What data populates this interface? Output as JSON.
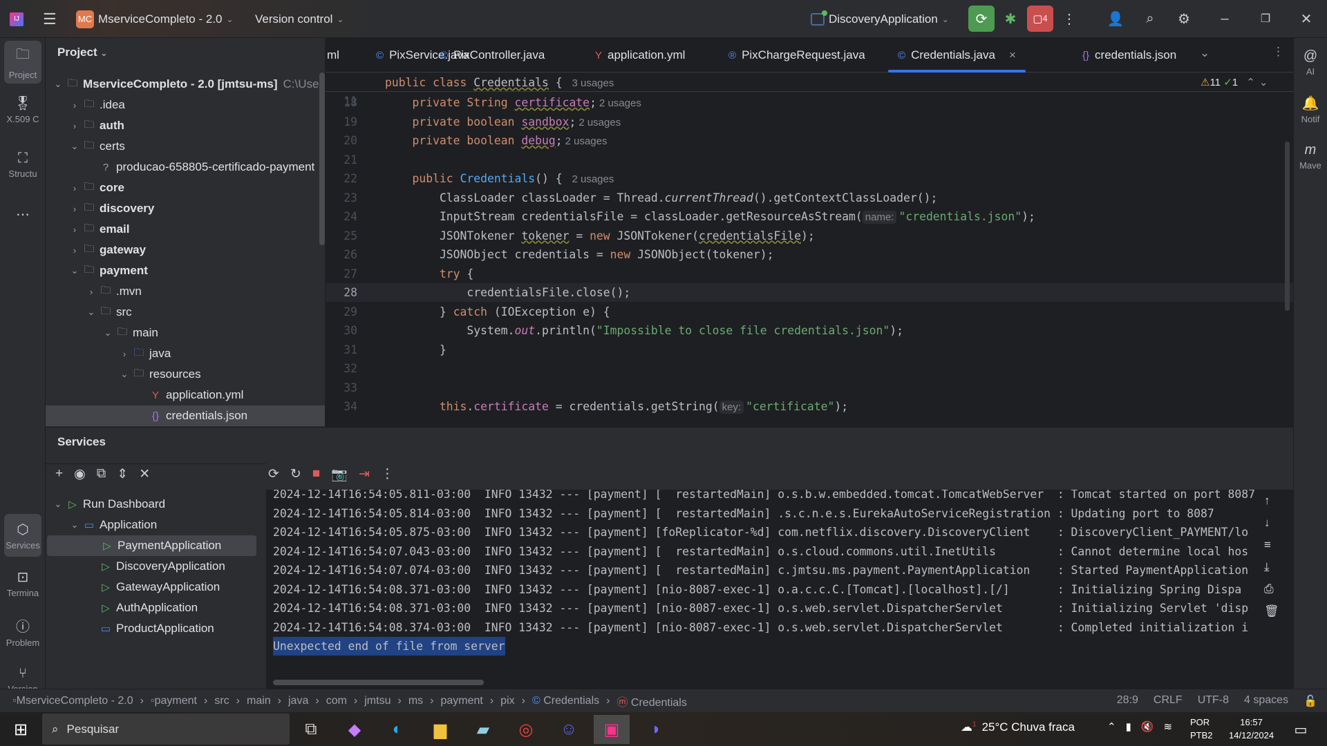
{
  "titlebar": {
    "project_initials": "MC",
    "project_name": "MserviceCompleto - 2.0",
    "vcs": "Version control",
    "run_config": "DiscoveryApplication",
    "stop_badge": "4"
  },
  "leftstrip": [
    {
      "label": "Project",
      "icon": "folder-icon"
    },
    {
      "label": "X.509 C",
      "icon": "certificate-icon"
    },
    {
      "label": "Structu",
      "icon": "structure-icon"
    },
    {
      "label": "Services",
      "icon": "services-icon"
    },
    {
      "label": "Termina",
      "icon": "terminal-icon"
    },
    {
      "label": "Problem",
      "icon": "problems-icon"
    },
    {
      "label": "Version",
      "icon": "git-branch-icon"
    }
  ],
  "project": {
    "title": "Project",
    "root_name": "MserviceCompleto - 2.0 [jmtsu-ms]",
    "root_path": "C:\\Use",
    "items": [
      {
        "label": ".idea",
        "depth": 1,
        "state": "collapsed",
        "kind": "folder"
      },
      {
        "label": "auth",
        "depth": 1,
        "state": "collapsed",
        "kind": "module",
        "bold": true
      },
      {
        "label": "certs",
        "depth": 1,
        "state": "expanded",
        "kind": "folder"
      },
      {
        "label": "producao-658805-certificado-payment",
        "depth": 2,
        "state": "leaf",
        "kind": "unknown"
      },
      {
        "label": "core",
        "depth": 1,
        "state": "collapsed",
        "kind": "module",
        "bold": true
      },
      {
        "label": "discovery",
        "depth": 1,
        "state": "collapsed",
        "kind": "module",
        "bold": true
      },
      {
        "label": "email",
        "depth": 1,
        "state": "collapsed",
        "kind": "module",
        "bold": true
      },
      {
        "label": "gateway",
        "depth": 1,
        "state": "collapsed",
        "kind": "module",
        "bold": true
      },
      {
        "label": "payment",
        "depth": 1,
        "state": "expanded",
        "kind": "module",
        "bold": true
      },
      {
        "label": ".mvn",
        "depth": 2,
        "state": "collapsed",
        "kind": "folder"
      },
      {
        "label": "src",
        "depth": 2,
        "state": "expanded",
        "kind": "folder"
      },
      {
        "label": "main",
        "depth": 3,
        "state": "expanded",
        "kind": "folder"
      },
      {
        "label": "java",
        "depth": 4,
        "state": "collapsed",
        "kind": "source"
      },
      {
        "label": "resources",
        "depth": 4,
        "state": "expanded",
        "kind": "resources"
      },
      {
        "label": "application.yml",
        "depth": 5,
        "state": "leaf",
        "kind": "yaml"
      },
      {
        "label": "credentials.json",
        "depth": 5,
        "state": "leaf",
        "kind": "json",
        "selected": true
      }
    ]
  },
  "tabs": [
    {
      "label": "ml",
      "kind": "partial"
    },
    {
      "label": "PixService.java",
      "kind": "class"
    },
    {
      "label": "PixController.java",
      "kind": "class"
    },
    {
      "label": "application.yml",
      "kind": "yaml"
    },
    {
      "label": "PixChargeRequest.java",
      "kind": "record"
    },
    {
      "label": "Credentials.java",
      "kind": "class",
      "active": true
    },
    {
      "label": "credentials.json",
      "kind": "json"
    }
  ],
  "inspections": {
    "warnings": "11",
    "ok": "1"
  },
  "sticky": {
    "num": "11",
    "tokens": [
      {
        "t": "public class ",
        "c": "kw"
      },
      {
        "t": "Credentials",
        "c": "pl ul"
      },
      {
        "t": " { ",
        "c": "pl"
      },
      {
        "t": "3 usages",
        "c": "hint"
      }
    ]
  },
  "code": [
    {
      "num": "18",
      "tokens": [
        {
          "t": "    private String ",
          "c": "kw"
        },
        {
          "t": "certificate",
          "c": "fld ul"
        },
        {
          "t": ";",
          "c": "pl"
        },
        {
          "t": "2 usages",
          "c": "hint"
        }
      ]
    },
    {
      "num": "19",
      "tokens": [
        {
          "t": "    private boolean ",
          "c": "kw"
        },
        {
          "t": "sandbox",
          "c": "fld ul"
        },
        {
          "t": ";",
          "c": "pl"
        },
        {
          "t": "2 usages",
          "c": "hint"
        }
      ]
    },
    {
      "num": "20",
      "tokens": [
        {
          "t": "    private boolean ",
          "c": "kw"
        },
        {
          "t": "debug",
          "c": "fld ul"
        },
        {
          "t": ";",
          "c": "pl"
        },
        {
          "t": "2 usages",
          "c": "hint"
        }
      ]
    },
    {
      "num": "21",
      "tokens": []
    },
    {
      "num": "22",
      "tokens": [
        {
          "t": "    public ",
          "c": "kw"
        },
        {
          "t": "Credentials",
          "c": "fn"
        },
        {
          "t": "() { ",
          "c": "pl"
        },
        {
          "t": "2 usages",
          "c": "hint"
        }
      ]
    },
    {
      "num": "23",
      "tokens": [
        {
          "t": "        ClassLoader classLoader = Thread.",
          "c": "pl"
        },
        {
          "t": "currentThread",
          "c": "pl it"
        },
        {
          "t": "().getContextClassLoader();",
          "c": "pl"
        }
      ]
    },
    {
      "num": "24",
      "tokens": [
        {
          "t": "        InputStream credentialsFile = classLoader.getResourceAsStream(",
          "c": "pl"
        },
        {
          "t": "name:",
          "c": "inlay"
        },
        {
          "t": "\"credentials.json\"",
          "c": "str"
        },
        {
          "t": ");",
          "c": "pl"
        }
      ]
    },
    {
      "num": "25",
      "tokens": [
        {
          "t": "        JSONTokener ",
          "c": "pl"
        },
        {
          "t": "tokener",
          "c": "pl ul"
        },
        {
          "t": " = ",
          "c": "pl"
        },
        {
          "t": "new ",
          "c": "kw"
        },
        {
          "t": "JSONTokener(",
          "c": "pl"
        },
        {
          "t": "credentialsFile",
          "c": "pl ul"
        },
        {
          "t": ");",
          "c": "pl"
        }
      ]
    },
    {
      "num": "26",
      "tokens": [
        {
          "t": "        JSONObject credentials = ",
          "c": "pl"
        },
        {
          "t": "new ",
          "c": "kw"
        },
        {
          "t": "JSONObject(tokener);",
          "c": "pl"
        }
      ]
    },
    {
      "num": "27",
      "tokens": [
        {
          "t": "        try ",
          "c": "kw"
        },
        {
          "t": "{",
          "c": "pl"
        }
      ]
    },
    {
      "num": "28",
      "current": true,
      "tokens": [
        {
          "t": "            credentialsFile.close();",
          "c": "pl"
        }
      ]
    },
    {
      "num": "29",
      "tokens": [
        {
          "t": "        } ",
          "c": "pl"
        },
        {
          "t": "catch ",
          "c": "kw"
        },
        {
          "t": "(IOException e) {",
          "c": "pl"
        }
      ]
    },
    {
      "num": "30",
      "tokens": [
        {
          "t": "            System.",
          "c": "pl"
        },
        {
          "t": "out",
          "c": "fld it"
        },
        {
          "t": ".println(",
          "c": "pl"
        },
        {
          "t": "\"Impossible to close file credentials.json\"",
          "c": "str"
        },
        {
          "t": ");",
          "c": "pl"
        }
      ]
    },
    {
      "num": "31",
      "tokens": [
        {
          "t": "        }",
          "c": "pl"
        }
      ]
    },
    {
      "num": "32",
      "tokens": []
    },
    {
      "num": "33",
      "tokens": []
    },
    {
      "num": "34",
      "tokens": [
        {
          "t": "        this",
          "c": "kw"
        },
        {
          "t": ".",
          "c": "pl"
        },
        {
          "t": "certificate",
          "c": "fld"
        },
        {
          "t": " = credentials.getString(",
          "c": "pl"
        },
        {
          "t": "key:",
          "c": "inlay"
        },
        {
          "t": "\"certificate\"",
          "c": "str"
        },
        {
          "t": ");",
          "c": "pl"
        }
      ]
    }
  ],
  "rightstrip": [
    {
      "label": "AI",
      "icon": "ai-assistant-icon"
    },
    {
      "label": "Notif",
      "icon": "bell-icon"
    },
    {
      "label": "Mave",
      "icon": "maven-icon"
    }
  ],
  "services": {
    "title": "Services",
    "tree": [
      {
        "label": "Run Dashboard",
        "depth": 0,
        "state": "expanded",
        "icon": "run-icon"
      },
      {
        "label": "Application",
        "depth": 1,
        "state": "expanded",
        "icon": "app-icon"
      },
      {
        "label": "PaymentApplication",
        "depth": 2,
        "icon": "run-icon",
        "selected": true
      },
      {
        "label": "DiscoveryApplication",
        "depth": 2,
        "icon": "run-icon"
      },
      {
        "label": "GatewayApplication",
        "depth": 2,
        "icon": "run-icon"
      },
      {
        "label": "AuthApplication",
        "depth": 2,
        "icon": "run-icon"
      },
      {
        "label": "ProductApplication",
        "depth": 2,
        "icon": "app-icon"
      }
    ],
    "log": [
      "2024-12-14T16:54:05.811-03:00  INFO 13432 --- [payment] [  restartedMain] o.s.b.w.embedded.tomcat.TomcatWebServer  : Tomcat started on port 8087",
      "2024-12-14T16:54:05.814-03:00  INFO 13432 --- [payment] [  restartedMain] .s.c.n.e.s.EurekaAutoServiceRegistration : Updating port to 8087",
      "2024-12-14T16:54:05.875-03:00  INFO 13432 --- [payment] [foReplicator-%d] com.netflix.discovery.DiscoveryClient    : DiscoveryClient_PAYMENT/lo",
      "2024-12-14T16:54:07.043-03:00  INFO 13432 --- [payment] [  restartedMain] o.s.cloud.commons.util.InetUtils         : Cannot determine local hos",
      "2024-12-14T16:54:07.074-03:00  INFO 13432 --- [payment] [  restartedMain] c.jmtsu.ms.payment.PaymentApplication    : Started PaymentApplication",
      "2024-12-14T16:54:08.371-03:00  INFO 13432 --- [payment] [nio-8087-exec-1] o.a.c.c.C.[Tomcat].[localhost].[/]       : Initializing Spring Dispa",
      "2024-12-14T16:54:08.371-03:00  INFO 13432 --- [payment] [nio-8087-exec-1] o.s.web.servlet.DispatcherServlet        : Initializing Servlet 'disp",
      "2024-12-14T16:54:08.374-03:00  INFO 13432 --- [payment] [nio-8087-exec-1] o.s.web.servlet.DispatcherServlet        : Completed initialization i"
    ],
    "error_line": "Unexpected end of file from server"
  },
  "breadcrumb": [
    "MserviceCompleto - 2.0",
    "payment",
    "src",
    "main",
    "java",
    "com",
    "jmtsu",
    "ms",
    "payment",
    "pix",
    "Credentials",
    "Credentials"
  ],
  "status": {
    "position": "28:9",
    "line_sep": "CRLF",
    "encoding": "UTF-8",
    "indent": "4 spaces"
  },
  "taskbar": {
    "search_placeholder": "Pesquisar",
    "weather": "25°C  Chuva fraca",
    "weather_badge": "1",
    "lang1": "POR",
    "lang2": "PTB2",
    "time": "16:57",
    "date": "14/12/2024"
  }
}
